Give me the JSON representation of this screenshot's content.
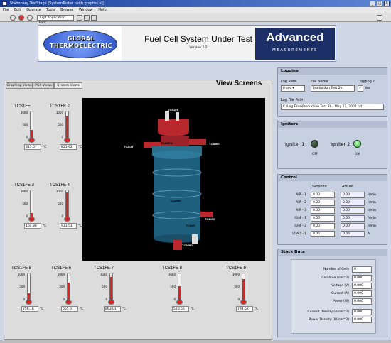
{
  "window": {
    "title": "Stationary TestStage [SystemTester (with graphs).vi]",
    "min": "_",
    "max": "□",
    "close": "X"
  },
  "menu": [
    "File",
    "Edit",
    "Operate",
    "Tools",
    "Browse",
    "Window",
    "Help"
  ],
  "toolbar": {
    "font_select": "13pt Application Font"
  },
  "header": {
    "logo_line1": "GLOBAL",
    "logo_line2": "THERMOELECTRIC",
    "title": "Fuel Cell System Under Test",
    "version": "Version 2.2",
    "brand_big": "Advanced",
    "brand_small": "MEASUREMENTS"
  },
  "tabs": [
    {
      "label": "Graphing Views"
    },
    {
      "label": "PGX Views"
    },
    {
      "label": "System Views"
    }
  ],
  "view_title": "View Screens",
  "thermometers": [
    {
      "label": "TCS1FE",
      "ticks": [
        "1000",
        "500",
        "0"
      ],
      "value": "315.07",
      "unit": "°C",
      "level": 0.32
    },
    {
      "label": "TCS1FE 2",
      "ticks": [
        "1000",
        "500",
        "0"
      ],
      "value": "821.92",
      "unit": "°C",
      "level": 0.82
    },
    {
      "label": "TCS1FE 3",
      "ticks": [
        "1000",
        "500",
        "0"
      ],
      "value": "164.38",
      "unit": "°C",
      "level": 0.16
    },
    {
      "label": "TCS1FE 4",
      "ticks": [
        "1000",
        "500",
        "0"
      ],
      "value": "931.51",
      "unit": "°C",
      "level": 0.93
    },
    {
      "label": "TCS1FE 5",
      "ticks": [
        "1000",
        "500",
        "0"
      ],
      "value": "256.16",
      "unit": "°C",
      "level": 0.26
    },
    {
      "label": "TCS1FE 6",
      "ticks": [
        "1000",
        "500",
        "0"
      ],
      "value": "665.67",
      "unit": "°C",
      "level": 0.67
    },
    {
      "label": "TCS1FE 7",
      "ticks": [
        "1000",
        "500",
        "0"
      ],
      "value": "863.01",
      "unit": "°C",
      "level": 0.86
    },
    {
      "label": "TCS1FE 8",
      "ticks": [
        "1000",
        "500",
        "0"
      ],
      "value": "520.55",
      "unit": "°C",
      "level": 0.52
    },
    {
      "label": "TCS1FE 9",
      "ticks": [
        "1000",
        "500",
        "0"
      ],
      "value": "794.52",
      "unit": "°C",
      "level": 0.79
    }
  ],
  "vessel_labels": [
    "TCS1FE",
    "TCAGT",
    "TCAREA",
    "TCAMO",
    "TCAMO",
    "TCAMNI",
    "TCAMX",
    "TCANX",
    "TCAREX",
    "TCAMX"
  ],
  "logging": {
    "header": "Logging",
    "rate_label": "Log Rate",
    "rate_value": "6 sec",
    "file_label": "File Name",
    "file_value": "Production Test 2b",
    "logging_label": "Logging ?",
    "logging_yes": "Yes",
    "path_label": "Log File Path",
    "path_value": "C:\\Log Files\\Production Test 2b - May 11, 2001.txt"
  },
  "igniters": {
    "header": "Igniters",
    "items": [
      {
        "label": "Igniter 1",
        "state": "OFF",
        "on": false
      },
      {
        "label": "Igniter 2",
        "state": "ON",
        "on": true
      }
    ]
  },
  "control": {
    "header": "Control",
    "col_setpoint": "Setpoint",
    "col_actual": "Actual",
    "rows": [
      {
        "label": "AIR - 1",
        "setpoint": "0.00",
        "actual": "0.00",
        "unit": "ℓ/min"
      },
      {
        "label": "AIR - 2",
        "setpoint": "0.00",
        "actual": "0.00",
        "unit": "ℓ/min"
      },
      {
        "label": "AIR - 3",
        "setpoint": "0.00",
        "actual": "0.00",
        "unit": "ℓ/min"
      },
      {
        "label": "CH4 - 1",
        "setpoint": "0.00",
        "actual": "0.00",
        "unit": "ℓ/min"
      },
      {
        "label": "CH4 - 2",
        "setpoint": "0.00",
        "actual": "0.00",
        "unit": "ℓ/min"
      },
      {
        "label": "LOAD - 1",
        "setpoint": "0.00",
        "actual": "0.00",
        "unit": "A"
      }
    ]
  },
  "stack": {
    "header": "Stack Data",
    "rows": [
      {
        "label": "Number of Cells",
        "value": "0"
      },
      {
        "label": "Cell Area (cm^2)",
        "value": "0.000"
      },
      {
        "label": "Voltage (V)",
        "value": "0.000"
      },
      {
        "label": "Current (A)",
        "value": "0.000"
      },
      {
        "label": "Power (W)",
        "value": "0.000"
      },
      {
        "label": "Current Density (A/cm^2)",
        "value": "0.000"
      },
      {
        "label": "Power Density (W/cm^2)",
        "value": "0.000"
      }
    ]
  }
}
